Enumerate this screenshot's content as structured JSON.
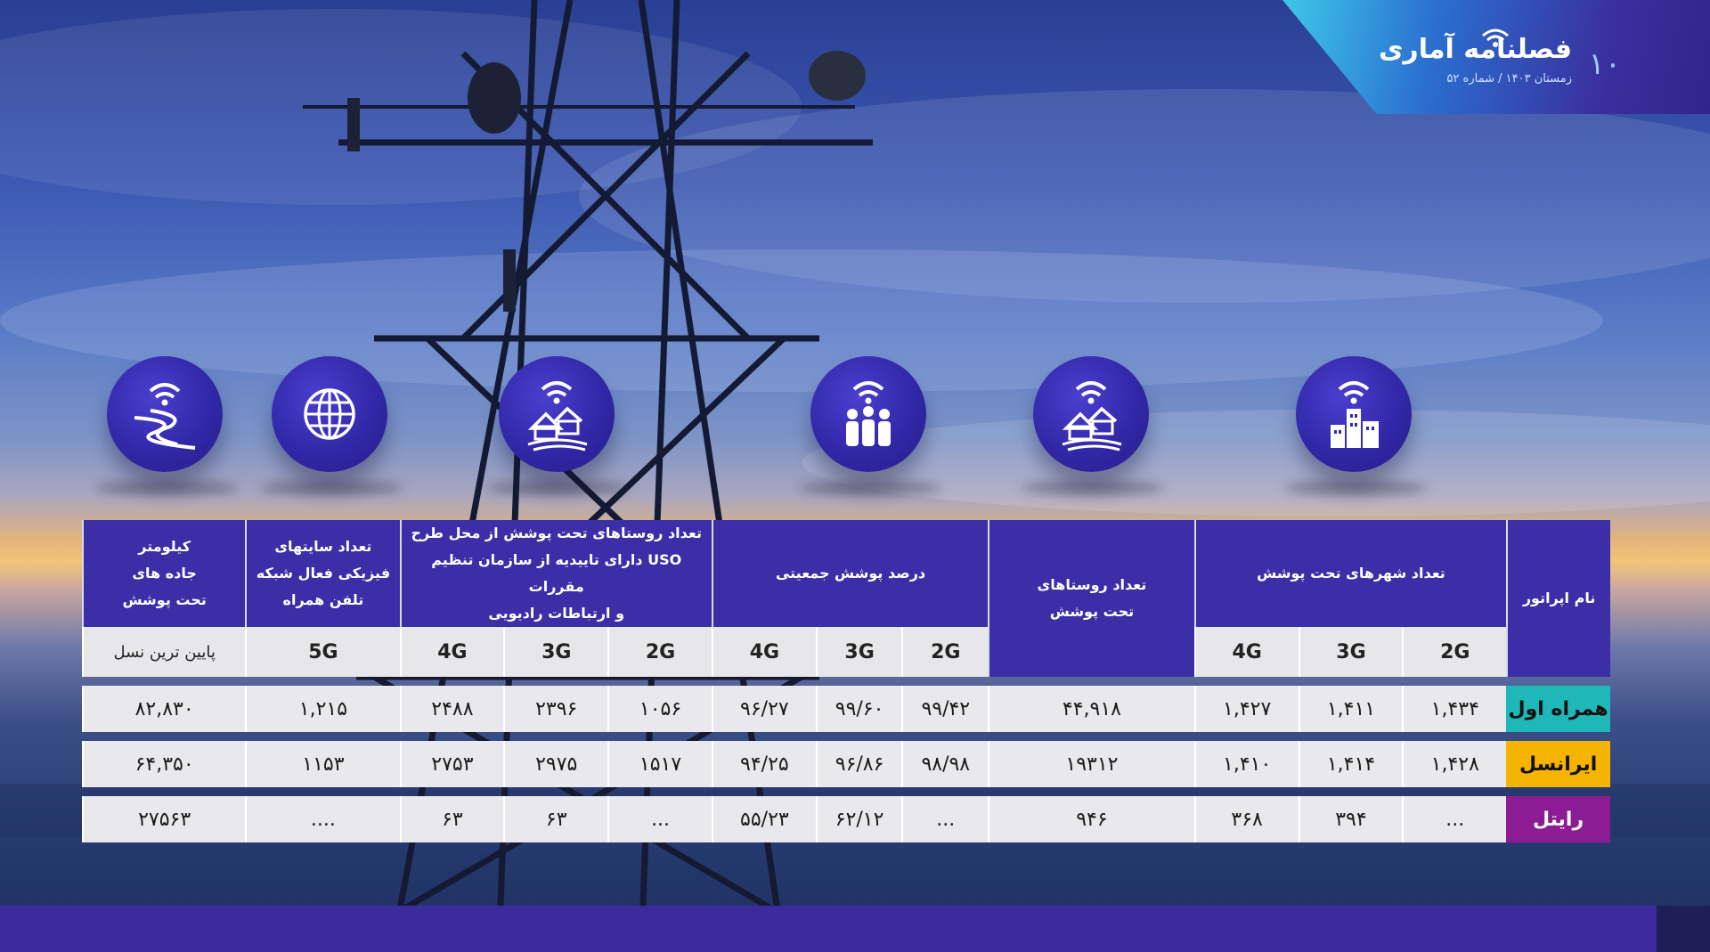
{
  "header": {
    "page_number": "۱۰",
    "brand_title": "فصلنامه آماری",
    "brand_subtitle": "زمستان ۱۴۰۳ / شماره ۵۲"
  },
  "icons": {
    "road": "road-wifi-icon",
    "globe": "globe-icon",
    "village_uso": "village-wifi-icon",
    "population": "population-wifi-icon",
    "village": "village-wifi-icon",
    "city": "city-wifi-icon"
  },
  "table": {
    "headers": {
      "operator": "نام اپراتور",
      "cities": "تعداد شهرهای تحت پوشش",
      "villages_l1": "تعداد روستاهای",
      "villages_l2": "تحت پوشش",
      "population": "درصد پوشش جمعیتی",
      "uso_l1": "تعداد روستاهای تحت پوشش از محل طرح",
      "uso_l2": "USO دارای تاییدیه از سازمان تنظیم مقررات",
      "uso_l3": "و ارتباطات رادیویی",
      "sites_l1": "تعداد سایتهای",
      "sites_l2": "فیزیکی فعال شبکه",
      "sites_l3": "تلفن همراه",
      "roads_l1": "کیلومتر",
      "roads_l2": "جاده های",
      "roads_l3": "تحت پوشش"
    },
    "sub": {
      "g2": "2G",
      "g3": "3G",
      "g4": "4G",
      "g5": "5G",
      "lowest": "پایین ترین نسل"
    },
    "rows": [
      {
        "operator": "همراه اول",
        "city_2g": "۱,۴۳۴",
        "city_3g": "۱,۴۱۱",
        "city_4g": "۱,۴۲۷",
        "villages": "۴۴,۹۱۸",
        "pop_2g": "۹۹/۴۲",
        "pop_3g": "۹۹/۶۰",
        "pop_4g": "۹۶/۲۷",
        "uso_2g": "۱۰۵۶",
        "uso_3g": "۲۳۹۶",
        "uso_4g": "۲۴۸۸",
        "sites_5g": "۱,۲۱۵",
        "roads": "۸۲,۸۳۰"
      },
      {
        "operator": "ایرانسل",
        "city_2g": "۱,۴۲۸",
        "city_3g": "۱,۴۱۴",
        "city_4g": "۱,۴۱۰",
        "villages": "۱۹۳۱۲",
        "pop_2g": "۹۸/۹۸",
        "pop_3g": "۹۶/۸۶",
        "pop_4g": "۹۴/۲۵",
        "uso_2g": "۱۵۱۷",
        "uso_3g": "۲۹۷۵",
        "uso_4g": "۲۷۵۳",
        "sites_5g": "۱۱۵۳",
        "roads": "۶۴,۳۵۰"
      },
      {
        "operator": "رایتل",
        "city_2g": "...",
        "city_3g": "۳۹۴",
        "city_4g": "۳۶۸",
        "villages": "۹۴۶",
        "pop_2g": "...",
        "pop_3g": "۶۲/۱۲",
        "pop_4g": "۵۵/۲۳",
        "uso_2g": "...",
        "uso_3g": "۶۳",
        "uso_4g": "۶۳",
        "sites_5g": "....",
        "roads": "۲۷۵۶۳"
      }
    ]
  }
}
